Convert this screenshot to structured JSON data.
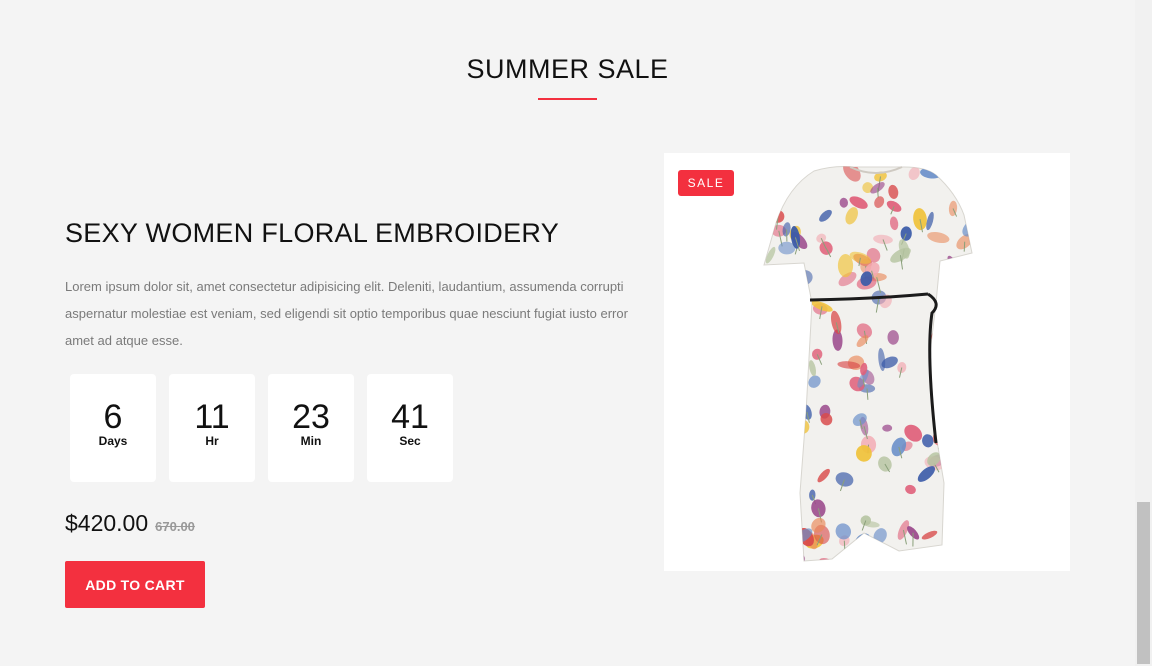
{
  "section": {
    "title": "SUMMER SALE",
    "accent_color": "#f3303f"
  },
  "product": {
    "name": "SEXY WOMEN FLORAL EMBROIDERY",
    "description": "Lorem ipsum dolor sit, amet consectetur adipisicing elit. Deleniti, laudantium, assumenda corrupti aspernatur molestiae est veniam, sed eligendi sit optio temporibus quae nesciunt fugiat iusto error amet ad atque esse.",
    "price": "$420.00",
    "old_price": "670.00",
    "badge": "SALE",
    "image_icon": "floral-dress-image"
  },
  "countdown": [
    {
      "value": "6",
      "label": "Days"
    },
    {
      "value": "11",
      "label": "Hr"
    },
    {
      "value": "23",
      "label": "Min"
    },
    {
      "value": "41",
      "label": "Sec"
    }
  ],
  "cart_button": {
    "label": "ADD TO CART"
  }
}
